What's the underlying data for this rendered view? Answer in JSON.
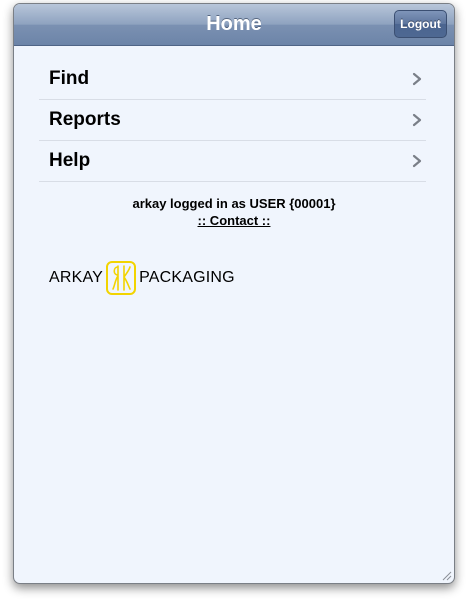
{
  "header": {
    "title": "Home",
    "logout_label": "Logout"
  },
  "menu": {
    "items": [
      {
        "label": "Find"
      },
      {
        "label": "Reports"
      },
      {
        "label": "Help"
      }
    ]
  },
  "status": {
    "logged_in_text": "arkay logged in as USER {00001}",
    "contact_link": ":: Contact ::"
  },
  "logo": {
    "left_word": "ARKAY",
    "right_word": "PACKAGING",
    "mark_color": "#f2d400",
    "monogram": "RK"
  },
  "colors": {
    "background": "#f0f5fd",
    "titlebar_top": "#b8c6da",
    "titlebar_bottom": "#6c84a8",
    "chevron": "#7a7f88",
    "divider": "#d8dde6"
  },
  "icons": {
    "menu_chevron": "chevron-right-icon",
    "resize": "resize-grip-icon"
  }
}
